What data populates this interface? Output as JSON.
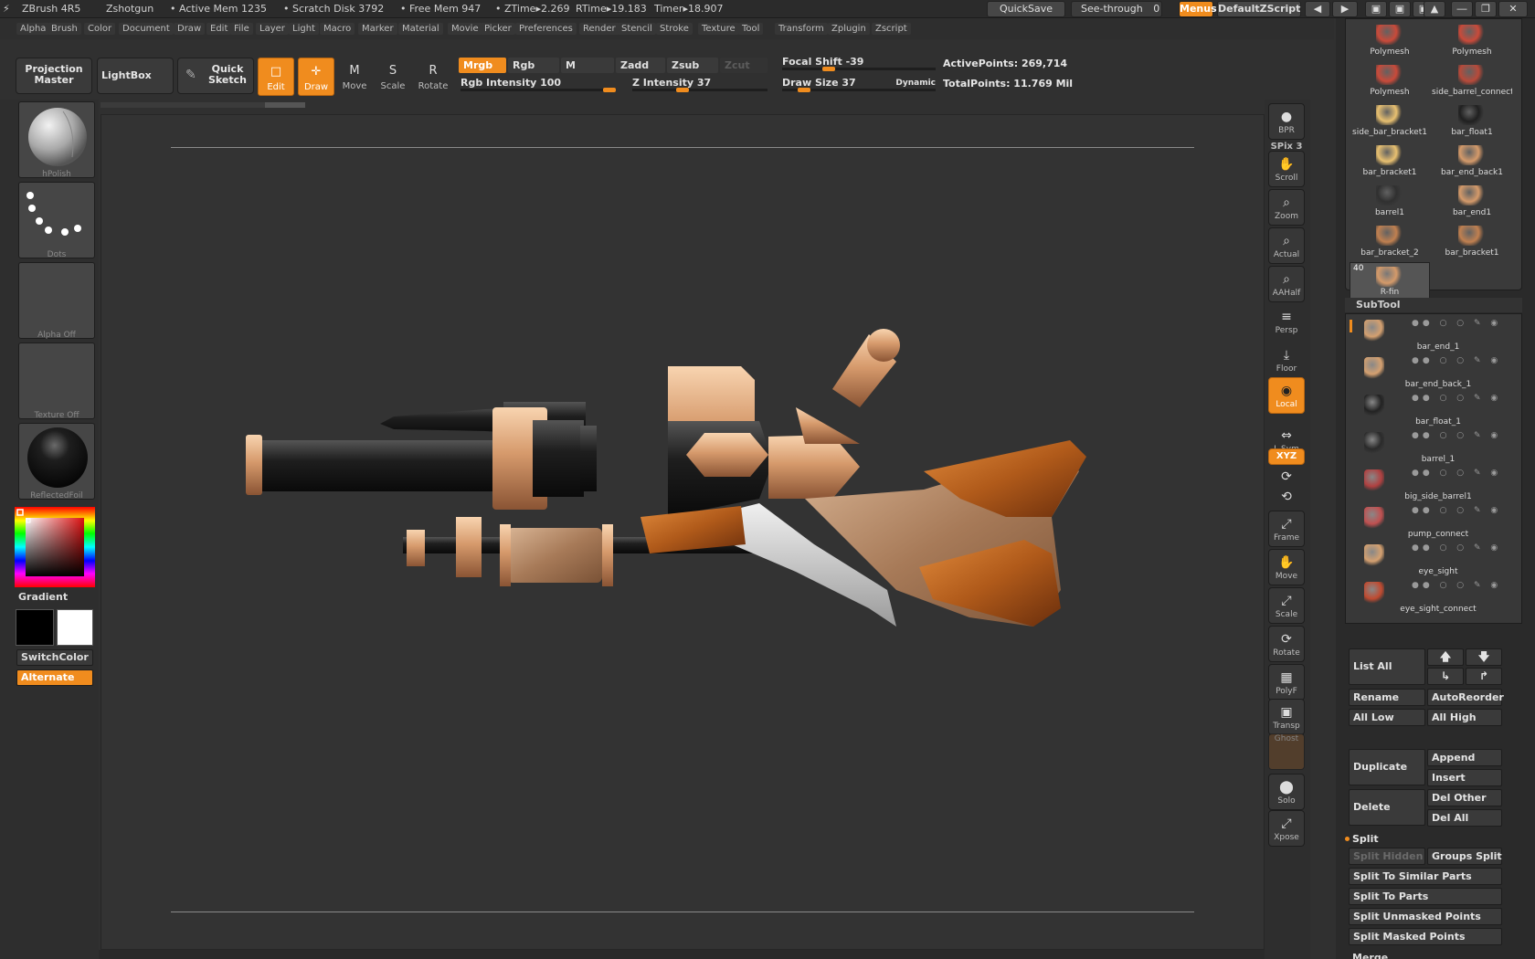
{
  "titlebar": {
    "app": "ZBrush 4R5",
    "doc": "Zshotgun",
    "active_mem": "• Active Mem 1235",
    "scratch": "• Scratch Disk 3792",
    "free_mem": "• Free Mem 947",
    "ztime": "• ZTime▸2.269",
    "rtime": "RTime▸19.183",
    "timer": "Timer▸18.907",
    "quicksave": "QuickSave",
    "see_through": "See-through",
    "see_through_value": "0",
    "menus": "Menus",
    "default_zscript": "DefaultZScript"
  },
  "menubar": [
    "Alpha",
    "Brush",
    "Color",
    "Document",
    "Draw",
    "Edit",
    "File",
    "Layer",
    "Light",
    "Macro",
    "Marker",
    "Material",
    "Movie",
    "Picker",
    "Preferences",
    "Render",
    "Stencil",
    "Stroke",
    "Texture",
    "Tool",
    "Transform",
    "Zplugin",
    "Zscript"
  ],
  "shelf": {
    "projection_master": "Projection Master",
    "lightbox": "LightBox",
    "quick_sketch": "Quick Sketch",
    "tools": [
      {
        "label": "Edit",
        "icon": "edit-icon",
        "glyph": "□"
      },
      {
        "label": "Draw",
        "icon": "draw-icon",
        "glyph": "✛"
      },
      {
        "label": "Move",
        "icon": "move-icon",
        "glyph": "M"
      },
      {
        "label": "Scale",
        "icon": "scale-icon",
        "glyph": "S"
      },
      {
        "label": "Rotate",
        "icon": "rotate-icon",
        "glyph": "R"
      }
    ],
    "mrgb": "Mrgb",
    "rgb": "Rgb",
    "m": "M",
    "zadd": "Zadd",
    "zsub": "Zsub",
    "zcut": "Zcut",
    "rgb_intensity": {
      "label": "Rgb Intensity 100",
      "value": 100
    },
    "z_intensity": {
      "label": "Z Intensity 37",
      "value": 37
    },
    "focal_shift": {
      "label": "Focal Shift -39",
      "value": -39
    },
    "draw_size": {
      "label": "Draw Size 37",
      "value": 37
    },
    "dynamic": "Dynamic",
    "active_points": "ActivePoints: 269,714",
    "total_points": "TotalPoints: 11.769 Mil"
  },
  "left_tray": {
    "brush": "hPolish",
    "stroke": "Dots",
    "alpha": "Alpha  Off",
    "texture": "Texture  Off",
    "material": "ReflectedFoil",
    "gradient": "Gradient",
    "switch_color": "SwitchColor",
    "alternate": "Alternate"
  },
  "right_tools": [
    {
      "label": "BPR",
      "icon": "bpr-sphere-icon",
      "glyph": "●"
    },
    {
      "label": "SPix 3",
      "icon": "spix-slider",
      "glyph": ""
    },
    {
      "label": "Scroll",
      "icon": "scroll-hand-icon",
      "glyph": "✋"
    },
    {
      "label": "Zoom",
      "icon": "zoom-icon",
      "glyph": "⌕"
    },
    {
      "label": "Actual",
      "icon": "actual-icon",
      "glyph": "⌕"
    },
    {
      "label": "AAHalf",
      "icon": "aahalf-icon",
      "glyph": "⌕"
    },
    {
      "label": "Persp",
      "icon": "persp-icon",
      "glyph": "≡"
    },
    {
      "label": "Floor",
      "icon": "floor-icon",
      "glyph": "⤓"
    },
    {
      "label": "Local",
      "icon": "local-icon",
      "glyph": "◉"
    },
    {
      "label": "L.Sym",
      "icon": "lsym-icon",
      "glyph": "⇔"
    },
    {
      "label": "XYZ",
      "icon": "xyz-icon",
      "glyph": ""
    },
    {
      "label": "",
      "icon": "rotate-y-icon",
      "glyph": "⟳"
    },
    {
      "label": "",
      "icon": "rotate-z-icon",
      "glyph": "⟲"
    },
    {
      "label": "Frame",
      "icon": "frame-icon",
      "glyph": "⤢"
    },
    {
      "label": "Move",
      "icon": "move-hand-icon",
      "glyph": "✋"
    },
    {
      "label": "Scale",
      "icon": "scale-view-icon",
      "glyph": "⤢"
    },
    {
      "label": "Rotate",
      "icon": "rotate-view-icon",
      "glyph": "⟳"
    },
    {
      "label": "PolyF",
      "icon": "polyframe-icon",
      "glyph": "▦"
    },
    {
      "label": "Transp",
      "icon": "transp-icon",
      "glyph": "▣"
    },
    {
      "label": "Ghost",
      "icon": "ghost-icon",
      "glyph": ""
    },
    {
      "label": "Solo",
      "icon": "solo-icon",
      "glyph": "⬤"
    },
    {
      "label": "Xpose",
      "icon": "xpose-icon",
      "glyph": "⤢"
    }
  ],
  "tool_palette": [
    {
      "name": "Polymesh",
      "color": "#c94a3a"
    },
    {
      "name": "Polymesh",
      "color": "#c94a3a"
    },
    {
      "name": "Polymesh",
      "color": "#c94a3a"
    },
    {
      "name": "side_barrel_connect",
      "color": "#b84a3a"
    },
    {
      "name": "side_bar_bracket1",
      "color": "#e8c070"
    },
    {
      "name": "bar_float1",
      "color": "#202020"
    },
    {
      "name": "bar_bracket1",
      "color": "#e8c070"
    },
    {
      "name": "bar_end_back1",
      "color": "#d49a6a"
    },
    {
      "name": "barrel1",
      "color": "#303030"
    },
    {
      "name": "bar_end1",
      "color": "#d49a6a"
    },
    {
      "name": "bar_bracket_2",
      "color": "#c08050"
    },
    {
      "name": "bar_bracket1",
      "color": "#c08050"
    },
    {
      "name": "R-fin",
      "color": "#d49a6a",
      "count": "40"
    }
  ],
  "subtool": {
    "header": "SubTool",
    "items": [
      {
        "name": "bar_end_1",
        "color": "#d4a070"
      },
      {
        "name": "bar_end_back_1",
        "color": "#d4a070"
      },
      {
        "name": "bar_float_1",
        "color": "#222222"
      },
      {
        "name": "barrel_1",
        "color": "#2a2a2a"
      },
      {
        "name": "big_side_barrel1",
        "color": "#b04040"
      },
      {
        "name": "pump_connect",
        "color": "#c05050"
      },
      {
        "name": "eye_sight",
        "color": "#d4a070"
      },
      {
        "name": "eye_sight_connect",
        "color": "#c04a30"
      }
    ],
    "list_all": "List All",
    "rename": "Rename",
    "auto_reorder": "AutoReorder",
    "all_low": "All Low",
    "all_high": "All High",
    "duplicate": "Duplicate",
    "append": "Append",
    "insert": "Insert",
    "delete": "Delete",
    "del_other": "Del Other",
    "del_all": "Del All",
    "split": "Split",
    "split_hidden": "Split Hidden",
    "groups_split": "Groups Split",
    "split_similar": "Split To Similar Parts",
    "split_parts": "Split To Parts",
    "split_unmasked": "Split Unmasked Points",
    "split_masked": "Split Masked Points",
    "merge": "Merge"
  },
  "colors": {
    "accent": "#f08c1e",
    "panel": "#3a3a3a",
    "canvas": "#333333"
  }
}
